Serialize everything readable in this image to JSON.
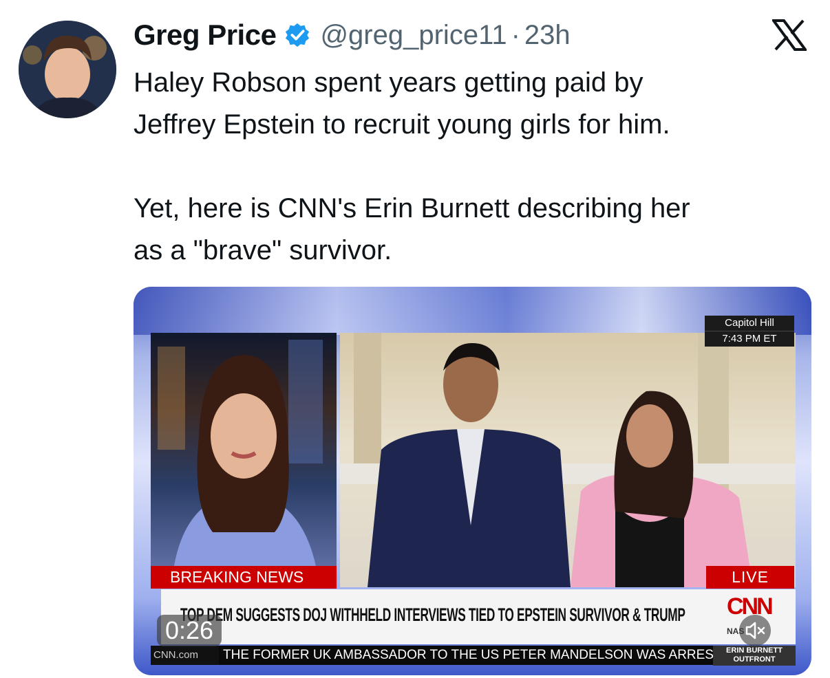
{
  "author": {
    "name": "Greg Price",
    "handle": "@greg_price11",
    "separator": "·",
    "time": "23h",
    "verified": true
  },
  "tweet": {
    "line1": "Haley Robson spent years getting paid by",
    "line2": "Jeffrey Epstein to recruit young girls for him.",
    "line3": "Yet, here is CNN's Erin Burnett describing her",
    "line4": "as a \"brave\" survivor."
  },
  "video": {
    "location": "Capitol Hill",
    "clock": "7:43 PM ET",
    "breaking_label": "BREAKING NEWS",
    "live_label": "LIVE",
    "headline": "TOP DEM SUGGESTS DOJ WITHHELD INTERVIEWS TIED TO EPSTEIN SURVIVOR & TRUMP",
    "network_logo": "CNN",
    "market": "NAS",
    "site": "CNN.com",
    "ticker": "THE FORMER UK AMBASSADOR TO THE US PETER MANDELSON WAS ARREST",
    "show_line1": "ERIN BURNETT",
    "show_line2": "OUTFRONT",
    "timestamp": "0:26"
  },
  "icons": {
    "verified": "verified-badge-icon",
    "brand": "x-logo-icon",
    "mute": "speaker-muted-icon"
  },
  "colors": {
    "verified": "#1d9bf0",
    "cnn_red": "#cc0000",
    "muted_text": "#536471"
  }
}
